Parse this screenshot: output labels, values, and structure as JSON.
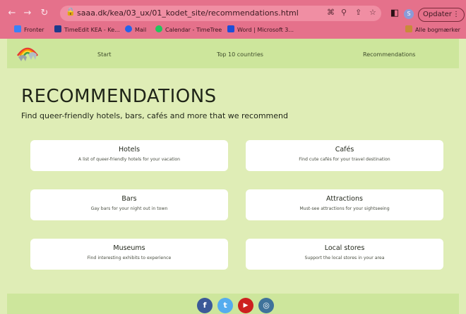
{
  "browser": {
    "url": "saaa.dk/kea/03_ux/01_kodet_site/recommendations.html",
    "update_button": "Opdater",
    "profile_initial": "S",
    "bookmarks": [
      {
        "label": "Fronter",
        "color": "#3b82f6"
      },
      {
        "label": "TimeEdit KEA - Ke...",
        "color": "#1e3a8a"
      },
      {
        "label": "Mail",
        "color": "#2563eb"
      },
      {
        "label": "Calendar - TimeTree",
        "color": "#22c55e"
      },
      {
        "label": "Word | Microsoft 3...",
        "color": "#1d4ed8"
      }
    ],
    "all_bookmarks": "Alle bogmærker"
  },
  "nav": {
    "items": [
      "Start",
      "Top 10 countries",
      "Recommendations"
    ]
  },
  "page": {
    "title": "RECOMMENDATIONS",
    "subtitle": "Find queer-friendly hotels, bars, cafés and more that we recommend"
  },
  "cards": [
    {
      "title": "Hotels",
      "desc": "A list of queer-friendly hotels for your vacation"
    },
    {
      "title": "Cafés",
      "desc": "Find cute cafés for your travel destination"
    },
    {
      "title": "Bars",
      "desc": "Gay bars for your night out in town"
    },
    {
      "title": "Attractions",
      "desc": "Must-see attractions for your sightseeing"
    },
    {
      "title": "Museums",
      "desc": "Find interesting exhibits to experience"
    },
    {
      "title": "Local stores",
      "desc": "Support the local stores in your area"
    }
  ],
  "footer": {
    "socials": [
      {
        "icon": "facebook-icon",
        "glyph": "f",
        "color": "#3b5998"
      },
      {
        "icon": "twitter-icon",
        "glyph": "t",
        "color": "#55acee"
      },
      {
        "icon": "youtube-icon",
        "glyph": "▶",
        "color": "#cd201f"
      },
      {
        "icon": "instagram-icon",
        "glyph": "◎",
        "color": "#3f729b"
      }
    ]
  }
}
